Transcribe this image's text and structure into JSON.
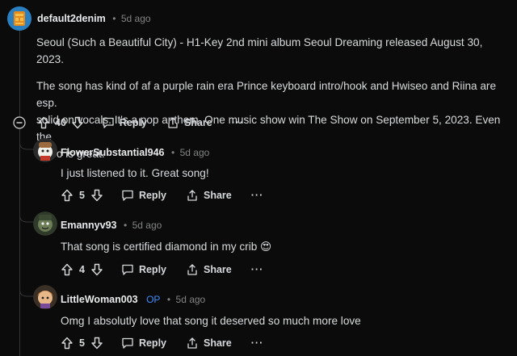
{
  "top": {
    "username": "default2denim",
    "time": "5d ago",
    "paragraph1": "Seoul (Such a Beautiful City) - H1-Key 2nd mini album Seoul Dreaming released August 30, 2023.",
    "paragraph2_line1": "The song has kind of af a purple rain era Prince keyboard intro/hook and Hwiseo and Riina are esp.",
    "paragraph2_line2": "solid on vocals. It's a pop anthem. One music show win The Show on September 5, 2023. Even the",
    "paragraph2_line3": "video is great.",
    "votes": "40",
    "reply_label": "Reply",
    "share_label": "Share",
    "more": "···"
  },
  "replies": [
    {
      "username": "FlowerSubstantial946",
      "time": "5d ago",
      "text": "I just listened to it. Great song!",
      "votes": "5",
      "reply_label": "Reply",
      "share_label": "Share",
      "more": "···"
    },
    {
      "username": "Emannyv93",
      "time": "5d ago",
      "text": "That song is certified diamond in my crib 😍",
      "votes": "4",
      "reply_label": "Reply",
      "share_label": "Share",
      "more": "···"
    },
    {
      "username": "LittleWoman003",
      "op_badge": "OP",
      "time": "5d ago",
      "text": "Omg I absolutly love that song it deserved so much more love",
      "votes": "5",
      "reply_label": "Reply",
      "share_label": "Share",
      "more": "···"
    }
  ],
  "separator": "•",
  "colors": {
    "background": "#0b0b0b",
    "text": "#d7dadc",
    "meta": "#818384",
    "op": "#3d8bfd"
  },
  "icons": [
    "upvote-icon",
    "downvote-icon",
    "comment-icon",
    "share-icon",
    "collapse-icon"
  ]
}
